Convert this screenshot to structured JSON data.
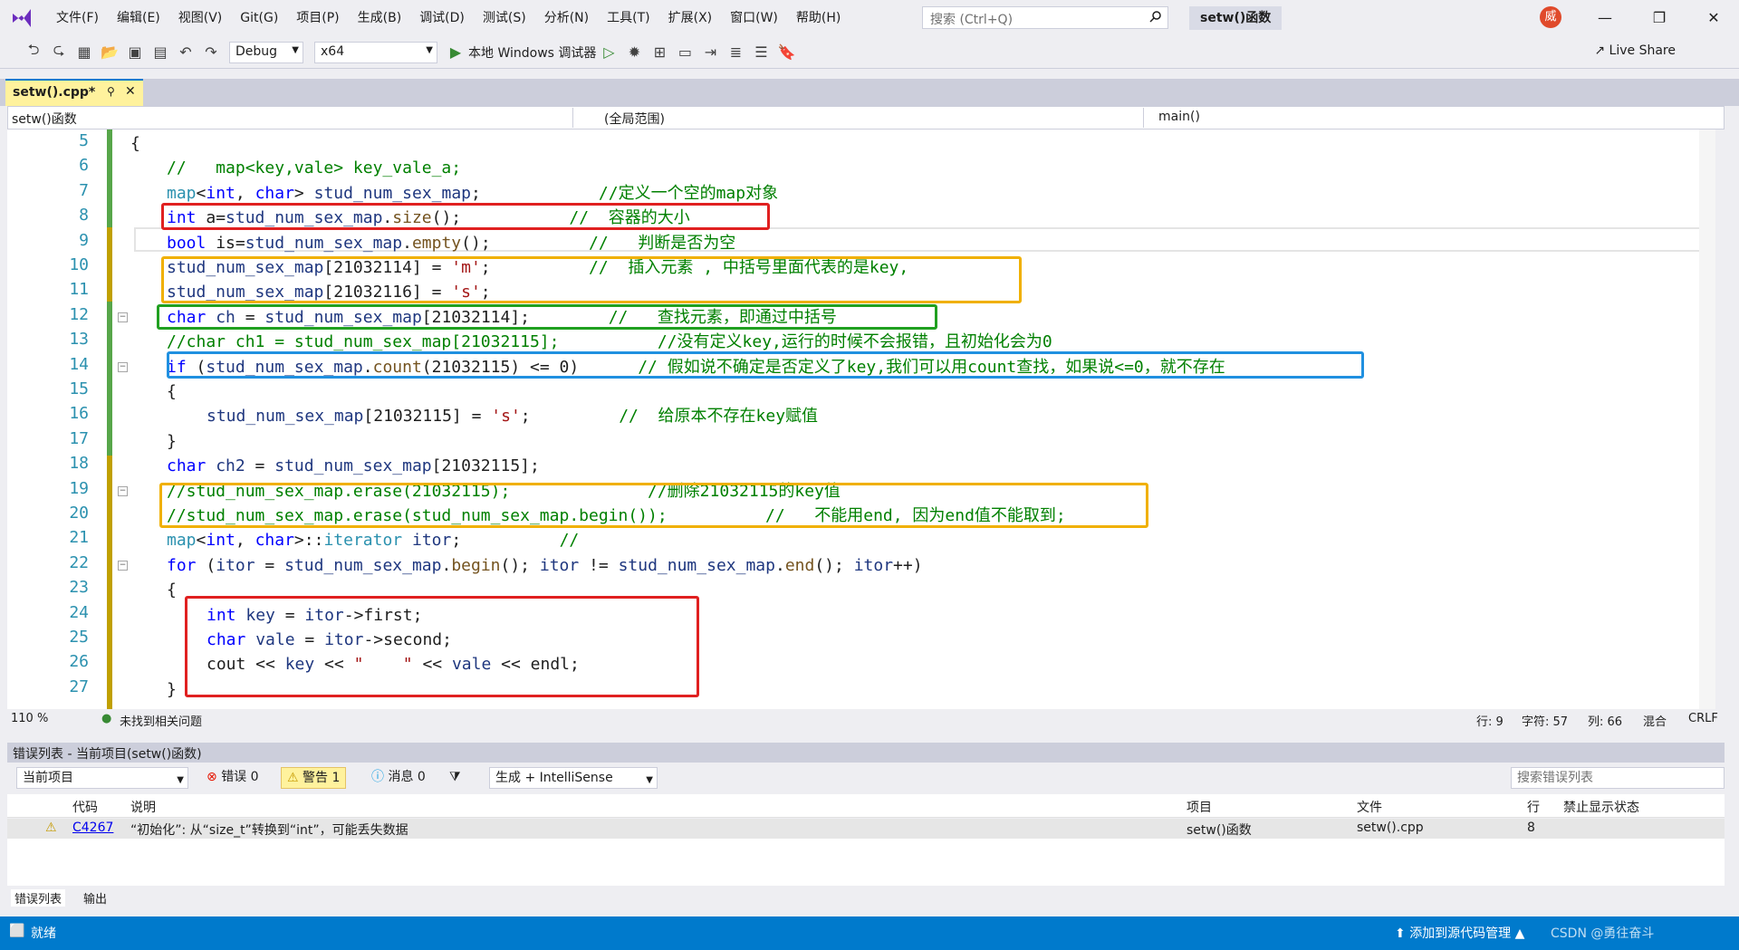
{
  "menu": {
    "items": [
      "文件(F)",
      "编辑(E)",
      "视图(V)",
      "Git(G)",
      "项目(P)",
      "生成(B)",
      "调试(D)",
      "测试(S)",
      "分析(N)",
      "工具(T)",
      "扩展(X)",
      "窗口(W)",
      "帮助(H)"
    ],
    "search_placeholder": "搜索 (Ctrl+Q)",
    "solution_title": "setw()函数",
    "avatar_initial": "威"
  },
  "toolbar": {
    "config": "Debug",
    "platform": "x64",
    "debugger": "本地 Windows 调试器",
    "live_share": "Live Share"
  },
  "tab": {
    "label": "setw().cpp*"
  },
  "nav": {
    "project": "setw()函数",
    "scope": "(全局范围)",
    "member": "main()"
  },
  "code_lines": [
    {
      "n": "5",
      "parts": [
        [
          "p",
          "{"
        ]
      ],
      "x": 0
    },
    {
      "n": "6",
      "parts": [
        [
          "c",
          "//   map<key,vale> key_vale_a;"
        ]
      ],
      "x": 1
    },
    {
      "n": "7",
      "parts": [
        [
          "t",
          "map"
        ],
        [
          "p",
          "<"
        ],
        [
          "k",
          "int"
        ],
        [
          "p",
          ", "
        ],
        [
          "k",
          "char"
        ],
        [
          "p",
          "> "
        ],
        [
          "v",
          "stud_num_sex_map"
        ],
        [
          "p",
          ";"
        ],
        [
          "p",
          "            "
        ],
        [
          "c",
          "//定义一个空的map对象"
        ]
      ],
      "x": 1
    },
    {
      "n": "8",
      "parts": [
        [
          "k",
          "int"
        ],
        [
          "p",
          " a="
        ],
        [
          "v",
          "stud_num_sex_map"
        ],
        [
          "p",
          "."
        ],
        [
          "f",
          "size"
        ],
        [
          "p",
          "();"
        ],
        [
          "p",
          "           "
        ],
        [
          "c",
          "//  容器的大小"
        ]
      ],
      "x": 1
    },
    {
      "n": "9",
      "parts": [
        [
          "k",
          "bool"
        ],
        [
          "p",
          " is="
        ],
        [
          "v",
          "stud_num_sex_map"
        ],
        [
          "p",
          "."
        ],
        [
          "f",
          "empty"
        ],
        [
          "p",
          "();"
        ],
        [
          "p",
          "          "
        ],
        [
          "c",
          "//   判断是否为空"
        ]
      ],
      "x": 1
    },
    {
      "n": "10",
      "parts": [
        [
          "v",
          "stud_num_sex_map"
        ],
        [
          "p",
          "[21032114] = "
        ],
        [
          "s",
          "'m'"
        ],
        [
          "p",
          ";"
        ],
        [
          "p",
          "          "
        ],
        [
          "c",
          "//  插入元素 , 中括号里面代表的是key,"
        ]
      ],
      "x": 1
    },
    {
      "n": "11",
      "parts": [
        [
          "v",
          "stud_num_sex_map"
        ],
        [
          "p",
          "[21032116] = "
        ],
        [
          "s",
          "'s'"
        ],
        [
          "p",
          ";"
        ]
      ],
      "x": 1
    },
    {
      "n": "12",
      "parts": [
        [
          "k",
          "char"
        ],
        [
          "p",
          " "
        ],
        [
          "v",
          "ch"
        ],
        [
          "p",
          " = "
        ],
        [
          "v",
          "stud_num_sex_map"
        ],
        [
          "p",
          "[21032114];"
        ],
        [
          "p",
          "        "
        ],
        [
          "c",
          "//   查找元素，即通过中括号"
        ]
      ],
      "x": 1
    },
    {
      "n": "13",
      "parts": [
        [
          "c",
          "//char ch1 = stud_num_sex_map[21032115];          //没有定义key,运行的时候不会报错，且初始化会为0"
        ]
      ],
      "x": 1
    },
    {
      "n": "14",
      "parts": [
        [
          "k",
          "if"
        ],
        [
          "p",
          " ("
        ],
        [
          "v",
          "stud_num_sex_map"
        ],
        [
          "p",
          "."
        ],
        [
          "f",
          "count"
        ],
        [
          "p",
          "(21032115) <= 0)"
        ],
        [
          "p",
          "      "
        ],
        [
          "c",
          "// 假如说不确定是否定义了key,我们可以用count查找，如果说<=0，就不存在"
        ]
      ],
      "x": 1
    },
    {
      "n": "15",
      "parts": [
        [
          "p",
          "{"
        ]
      ],
      "x": 1
    },
    {
      "n": "16",
      "parts": [
        [
          "v",
          "stud_num_sex_map"
        ],
        [
          "p",
          "[21032115] = "
        ],
        [
          "s",
          "'s'"
        ],
        [
          "p",
          ";"
        ],
        [
          "p",
          "         "
        ],
        [
          "c",
          "//  给原本不存在key赋值"
        ]
      ],
      "x": 2
    },
    {
      "n": "17",
      "parts": [
        [
          "p",
          "}"
        ]
      ],
      "x": 1
    },
    {
      "n": "18",
      "parts": [
        [
          "k",
          "char"
        ],
        [
          "p",
          " "
        ],
        [
          "v",
          "ch2"
        ],
        [
          "p",
          " = "
        ],
        [
          "v",
          "stud_num_sex_map"
        ],
        [
          "p",
          "[21032115];"
        ]
      ],
      "x": 1
    },
    {
      "n": "19",
      "parts": [
        [
          "c",
          "//stud_num_sex_map.erase(21032115);              //删除21032115的key值"
        ]
      ],
      "x": 1
    },
    {
      "n": "20",
      "parts": [
        [
          "c",
          "//stud_num_sex_map.erase(stud_num_sex_map.begin());          //   不能用end, 因为end值不能取到;"
        ]
      ],
      "x": 1
    },
    {
      "n": "21",
      "parts": [
        [
          "t",
          "map"
        ],
        [
          "p",
          "<"
        ],
        [
          "k",
          "int"
        ],
        [
          "p",
          ", "
        ],
        [
          "k",
          "char"
        ],
        [
          "p",
          ">::"
        ],
        [
          "t",
          "iterator"
        ],
        [
          "p",
          " "
        ],
        [
          "v",
          "itor"
        ],
        [
          "p",
          ";"
        ],
        [
          "p",
          "          "
        ],
        [
          "c",
          "//"
        ]
      ],
      "x": 1
    },
    {
      "n": "22",
      "parts": [
        [
          "k",
          "for"
        ],
        [
          "p",
          " ("
        ],
        [
          "v",
          "itor"
        ],
        [
          "p",
          " = "
        ],
        [
          "v",
          "stud_num_sex_map"
        ],
        [
          "p",
          "."
        ],
        [
          "f",
          "begin"
        ],
        [
          "p",
          "(); "
        ],
        [
          "v",
          "itor"
        ],
        [
          "p",
          " != "
        ],
        [
          "v",
          "stud_num_sex_map"
        ],
        [
          "p",
          "."
        ],
        [
          "f",
          "end"
        ],
        [
          "p",
          "(); "
        ],
        [
          "v",
          "itor"
        ],
        [
          "p",
          "++)"
        ]
      ],
      "x": 1
    },
    {
      "n": "23",
      "parts": [
        [
          "p",
          "{"
        ]
      ],
      "x": 1
    },
    {
      "n": "24",
      "parts": [
        [
          "k",
          "int"
        ],
        [
          "p",
          " "
        ],
        [
          "v",
          "key"
        ],
        [
          "p",
          " = "
        ],
        [
          "v",
          "itor"
        ],
        [
          "p",
          "->first;"
        ]
      ],
      "x": 2
    },
    {
      "n": "25",
      "parts": [
        [
          "k",
          "char"
        ],
        [
          "p",
          " "
        ],
        [
          "v",
          "vale"
        ],
        [
          "p",
          " = "
        ],
        [
          "v",
          "itor"
        ],
        [
          "p",
          "->second;"
        ]
      ],
      "x": 2
    },
    {
      "n": "26",
      "parts": [
        [
          "p",
          "cout << "
        ],
        [
          "v",
          "key"
        ],
        [
          "p",
          " << "
        ],
        [
          "s",
          "\"    \""
        ],
        [
          "p",
          " << "
        ],
        [
          "v",
          "vale"
        ],
        [
          "p",
          " << endl;"
        ]
      ],
      "x": 2
    },
    {
      "n": "27",
      "parts": [
        [
          "p",
          "}"
        ]
      ],
      "x": 1
    }
  ],
  "editor_status": {
    "zoom": "110 %",
    "issues": "未找到相关问题",
    "row": "行: 9",
    "char": "字符: 57",
    "col": "列: 66",
    "mix": "混合",
    "eol": "CRLF"
  },
  "error_panel": {
    "title": "错误列表 - 当前项目(setw()函数)",
    "scope": "当前项目",
    "errors": "错误 0",
    "warnings": "警告 1",
    "messages": "消息 0",
    "build_filter": "生成 + IntelliSense",
    "search_placeholder": "搜索错误列表",
    "columns": [
      "代码",
      "说明",
      "项目",
      "文件",
      "行",
      "禁止显示状态"
    ],
    "rows": [
      {
        "code": "C4267",
        "desc": "“初始化”: 从“size_t”转换到“int”，可能丢失数据",
        "project": "setw()函数",
        "file": "setw().cpp",
        "line": "8"
      }
    ]
  },
  "bottom_tabs": [
    "错误列表",
    "输出"
  ],
  "status": {
    "ready": "就绪",
    "source_control": "添加到源代码管理",
    "watermark": "CSDN @勇往奋斗"
  }
}
